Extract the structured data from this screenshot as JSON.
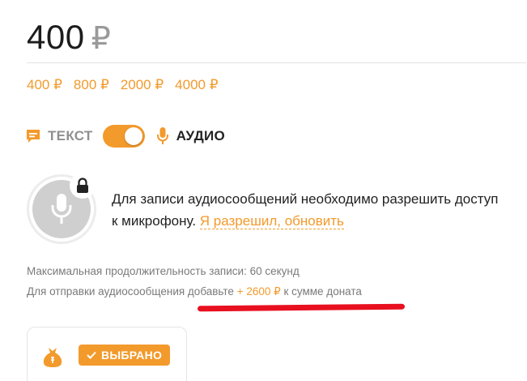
{
  "amount": {
    "value": "400",
    "currency": "₽"
  },
  "presets": [
    {
      "label": "400 ₽"
    },
    {
      "label": "800 ₽"
    },
    {
      "label": "2000 ₽"
    },
    {
      "label": "4000 ₽"
    }
  ],
  "mode": {
    "text_label": "ТЕКСТ",
    "audio_label": "АУДИО",
    "selected": "audio"
  },
  "permission": {
    "message": "Для записи аудиосообщений необходимо разрешить доступ к микрофону.",
    "link_label": "Я разрешил, обновить"
  },
  "info": {
    "max_duration": "Максимальная продолжительность записи: 60 секунд",
    "add_prefix": "Для отправки аудиосообщения добавьте",
    "add_amount": "+ 2600 ₽",
    "add_suffix": "к сумме доната"
  },
  "card": {
    "badge_label": "ВЫБРАНО"
  },
  "colors": {
    "accent": "#f39a2c",
    "highlight": "#e8101f",
    "muted": "#7a7a7a"
  }
}
